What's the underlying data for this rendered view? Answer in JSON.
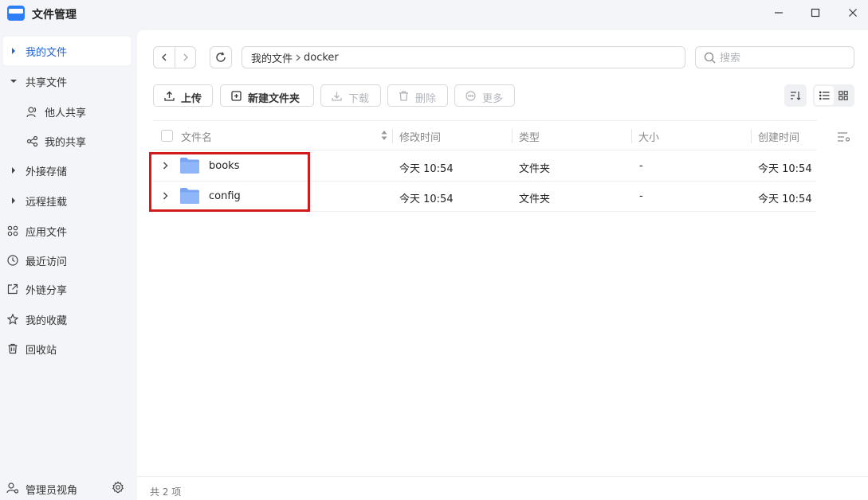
{
  "app": {
    "title": "文件管理",
    "brand_color": "#2d7ff9"
  },
  "window_controls": {
    "minimize": "minimize-icon",
    "maximize": "maximize-icon",
    "close": "close-icon"
  },
  "sidebar": {
    "items": [
      {
        "label": "我的文件",
        "icon": "caret-right-icon",
        "active": true
      },
      {
        "label": "共享文件",
        "icon": "caret-down-icon",
        "expanded": true
      },
      {
        "label": "他人共享",
        "icon": "users-icon"
      },
      {
        "label": "我的共享",
        "icon": "share-icon"
      },
      {
        "label": "外接存储",
        "icon": "caret-right-icon"
      },
      {
        "label": "远程挂载",
        "icon": "caret-right-icon"
      },
      {
        "label": "应用文件",
        "icon": "apps-icon"
      },
      {
        "label": "最近访问",
        "icon": "clock-icon"
      },
      {
        "label": "外链分享",
        "icon": "external-link-icon"
      },
      {
        "label": "我的收藏",
        "icon": "star-icon"
      },
      {
        "label": "回收站",
        "icon": "trash-icon"
      }
    ],
    "footer": {
      "label": "管理员视角",
      "icon": "admin-icon",
      "settings_icon": "gear-icon"
    }
  },
  "path": {
    "segments": [
      "我的文件",
      "docker"
    ]
  },
  "search": {
    "placeholder": "搜索"
  },
  "toolbar": {
    "upload": "上传",
    "new_folder": "新建文件夹",
    "download": "下载",
    "delete": "删除",
    "more": "更多"
  },
  "table": {
    "columns": {
      "name": "文件名",
      "modified": "修改时间",
      "type": "类型",
      "size": "大小",
      "created": "创建时间"
    },
    "rows": [
      {
        "name": "books",
        "modified": "今天 10:54",
        "type": "文件夹",
        "size": "-",
        "created": "今天 10:54"
      },
      {
        "name": "config",
        "modified": "今天 10:54",
        "type": "文件夹",
        "size": "-",
        "created": "今天 10:54"
      }
    ]
  },
  "status": {
    "count_text": "共 2 项"
  },
  "highlight_color": "#d2191c"
}
